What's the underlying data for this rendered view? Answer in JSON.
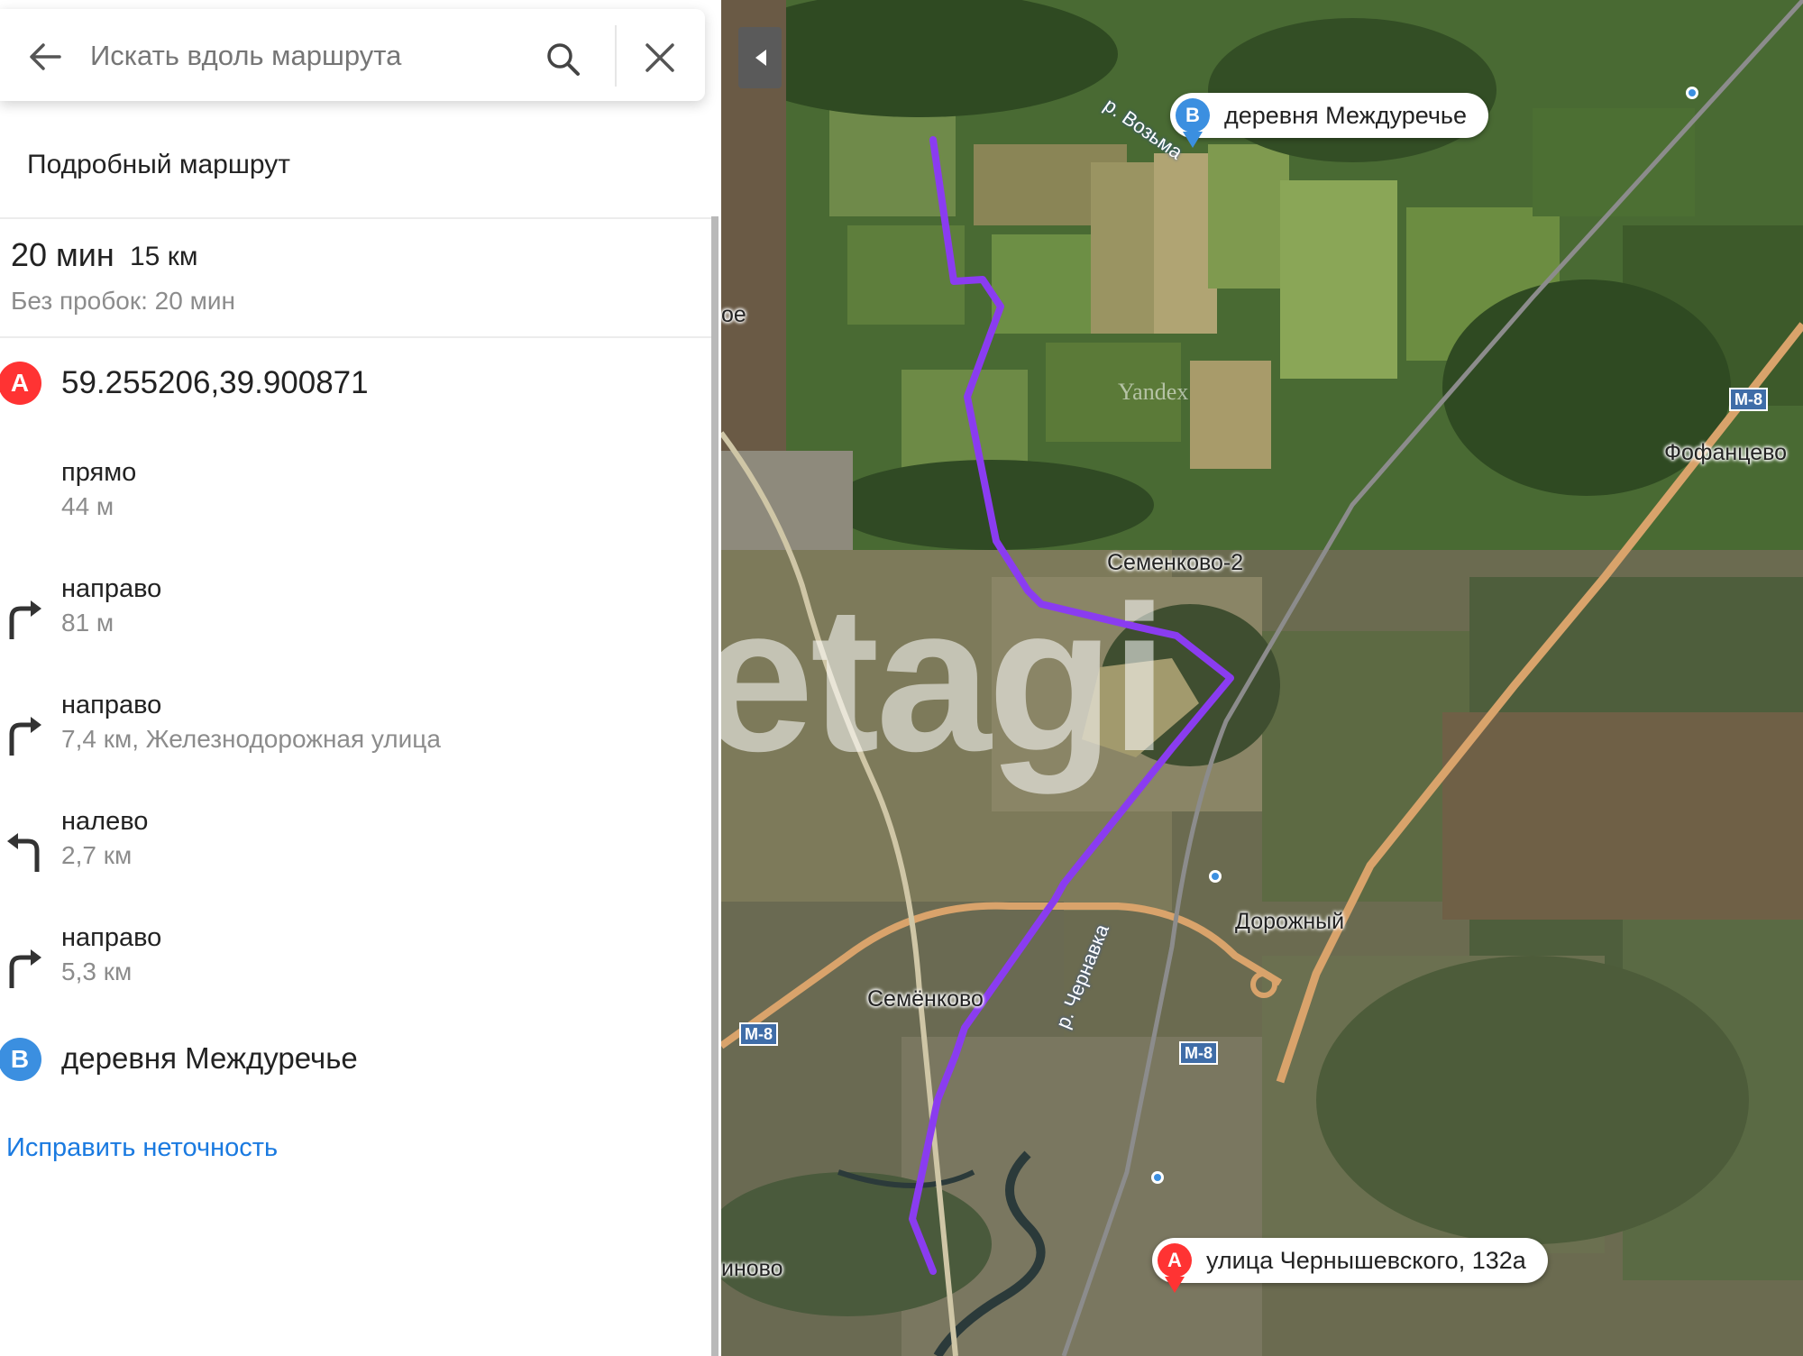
{
  "search": {
    "placeholder": "Искать вдоль маршрута"
  },
  "panel": {
    "title": "Подробный маршрут",
    "summary": {
      "time": "20 мин",
      "distance": "15 км",
      "no_traffic": "Без пробок: 20 мин"
    },
    "start": {
      "marker": "A",
      "label": "59.255206,39.900871",
      "color": "#ff3333"
    },
    "steps": [
      {
        "direction": "прямо",
        "detail": "44 м",
        "icon": "none"
      },
      {
        "direction": "направо",
        "detail": "81 м",
        "icon": "turn-right-icon"
      },
      {
        "direction": "направо",
        "detail": "7,4 км, Железнодорожная улица",
        "icon": "turn-right-icon"
      },
      {
        "direction": "налево",
        "detail": "2,7 км",
        "icon": "turn-left-icon"
      },
      {
        "direction": "направо",
        "detail": "5,3 км",
        "icon": "turn-right-icon"
      }
    ],
    "end": {
      "marker": "B",
      "label": "деревня Междуречье",
      "color": "#3b8fe0"
    },
    "fix_link": "Исправить неточность"
  },
  "map": {
    "route_color": "#8a3cf0",
    "destination_pin": {
      "marker": "B",
      "label": "деревня Междуречье"
    },
    "origin_pin": {
      "marker": "A",
      "label": "улица Чернышевского, 132а"
    },
    "place_labels": {
      "semenkovo2": "Семенково-2",
      "fofantsevo": "Фофанцево",
      "dorozhny": "Дорожный",
      "semyonkovo": "Семёнково",
      "river_vozma": "р. Возьма",
      "river_chernavka": "р. Чернавка",
      "partial_left": "ое",
      "partial_bottom": "иново"
    },
    "road_badges": {
      "m8_right": "М-8",
      "m8_left": "М-8",
      "m8_center": "М-8"
    },
    "tile_mark": "Yandex",
    "watermark": "etagi"
  }
}
